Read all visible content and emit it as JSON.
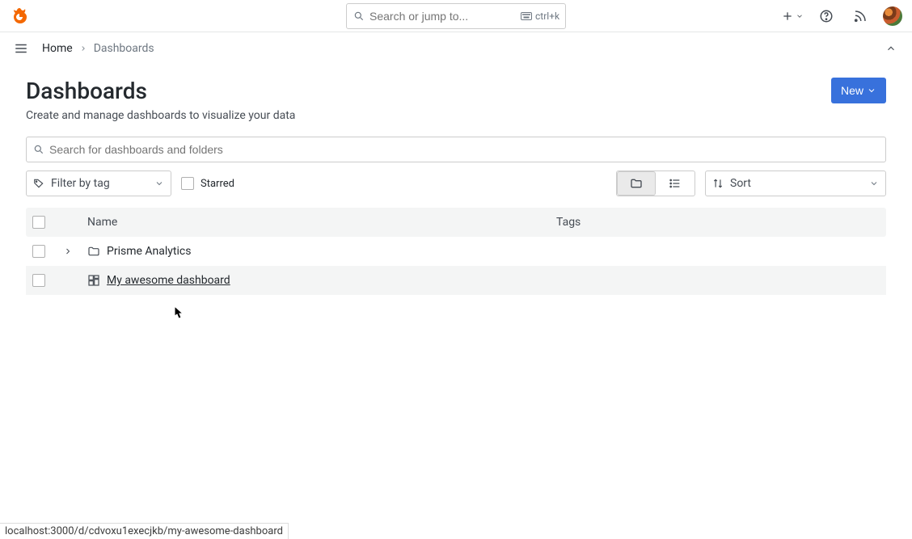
{
  "header": {
    "search_placeholder": "Search or jump to...",
    "shortcut": "ctrl+k"
  },
  "breadcrumb": {
    "home": "Home",
    "current": "Dashboards"
  },
  "page": {
    "title": "Dashboards",
    "subtitle": "Create and manage dashboards to visualize your data",
    "new_button": "New"
  },
  "toolbar": {
    "search_placeholder": "Search for dashboards and folders",
    "filter_tag_label": "Filter by tag",
    "starred_label": "Starred",
    "sort_label": "Sort"
  },
  "table": {
    "columns": {
      "name": "Name",
      "tags": "Tags"
    },
    "rows": [
      {
        "type": "folder",
        "name": "Prisme Analytics"
      },
      {
        "type": "dashboard",
        "name": "My awesome dashboard",
        "hovered": true
      }
    ]
  },
  "status_url": "localhost:3000/d/cdvoxu1execjkb/my-awesome-dashboard"
}
